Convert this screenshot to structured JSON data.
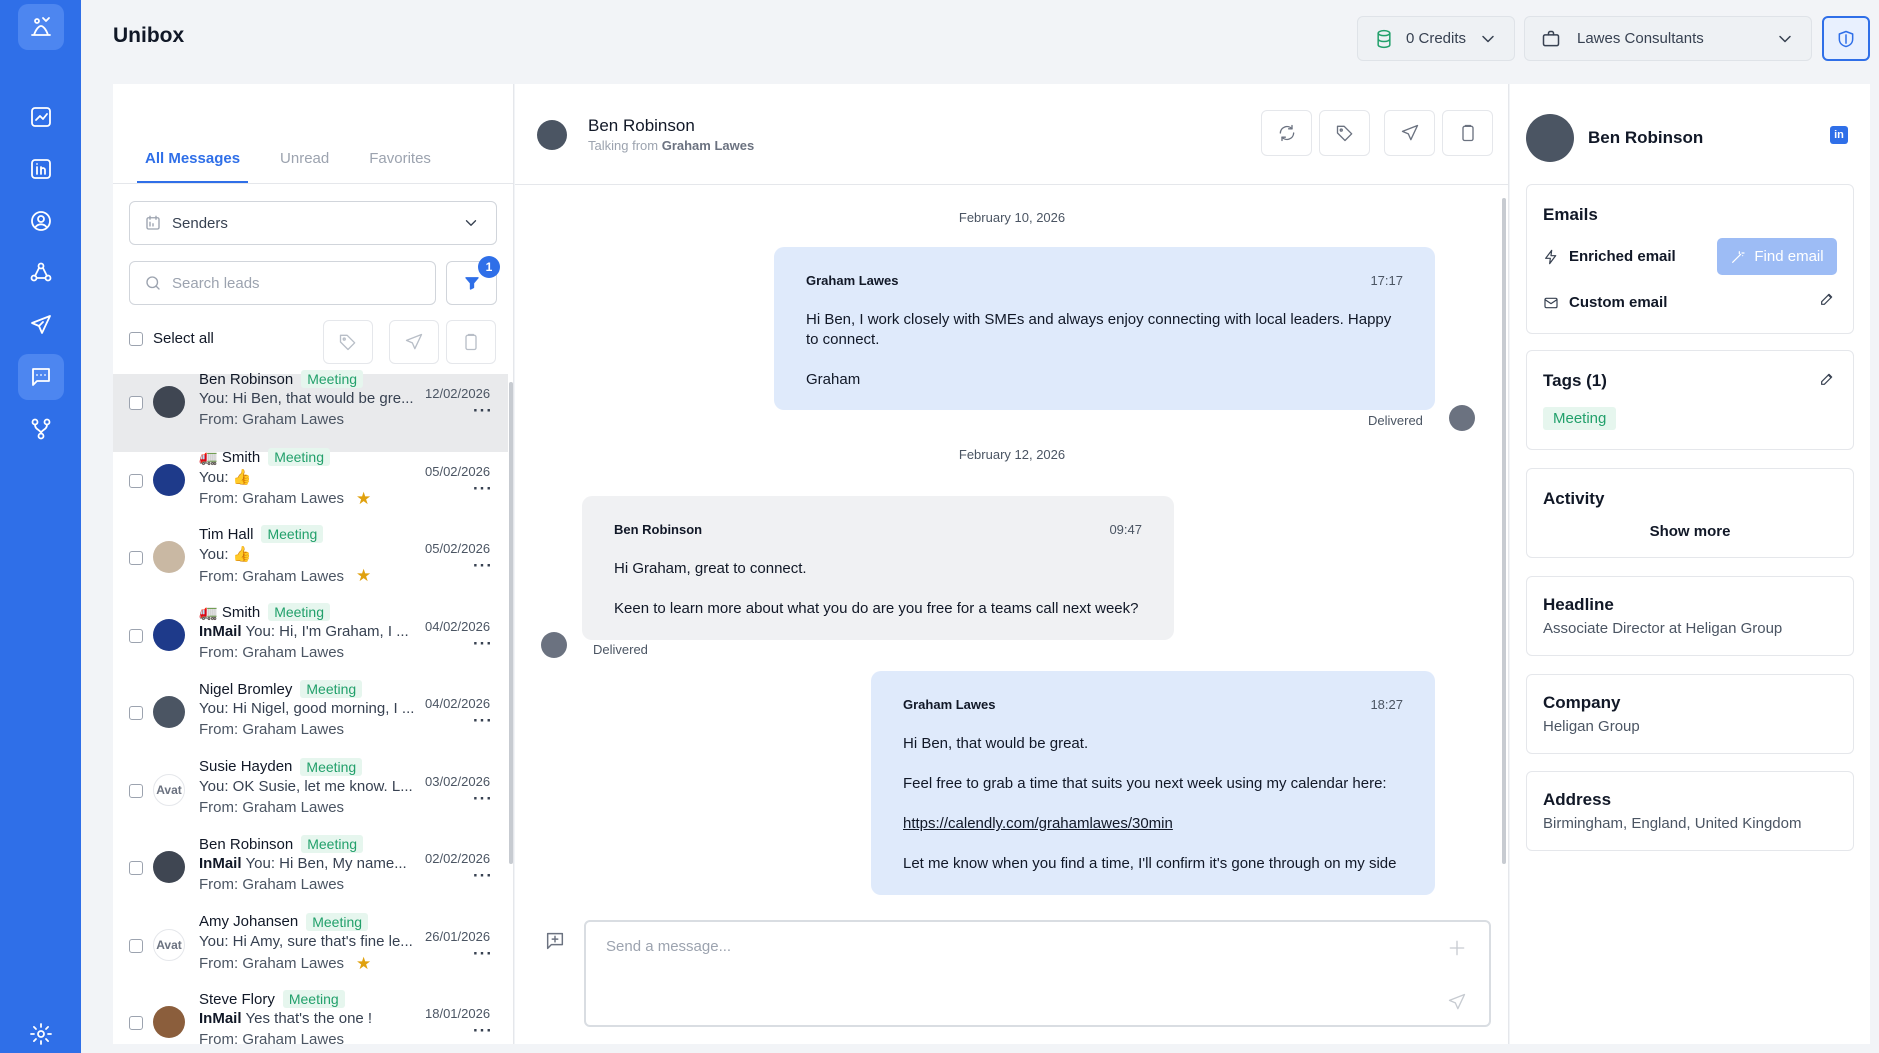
{
  "app": {
    "title": "Unibox"
  },
  "header": {
    "credits_label": "0 Credits",
    "org_label": "Lawes Consultants"
  },
  "sidebar": {
    "items": [
      "logo",
      "analytics",
      "linkedin",
      "contacts",
      "network",
      "campaigns",
      "unibox",
      "workflows",
      "settings"
    ]
  },
  "inbox": {
    "tabs": [
      {
        "label": "All Messages",
        "active": true
      },
      {
        "label": "Unread"
      },
      {
        "label": "Favorites"
      }
    ],
    "senders_label": "Senders",
    "search_placeholder": "Search leads",
    "filter_count": "1",
    "select_all_label": "Select all",
    "conversations": [
      {
        "name": "Ben Robinson",
        "tag": "Meeting",
        "prefix": "",
        "preview": "You: Hi Ben, that would be gre...",
        "from": "From: Graham Lawes",
        "date": "12/02/2026",
        "star": false,
        "active": true,
        "avatar_color": "#3f4652"
      },
      {
        "name": "🚛 Smith",
        "tag": "Meeting",
        "prefix": "",
        "preview": "You: 👍",
        "from": "From: Graham Lawes",
        "date": "05/02/2026",
        "star": true,
        "active": false,
        "avatar_color": "#1e3a8a"
      },
      {
        "name": "Tim Hall",
        "tag": "Meeting",
        "prefix": "",
        "preview": "You: 👍",
        "from": "From: Graham Lawes",
        "date": "05/02/2026",
        "star": true,
        "active": false,
        "avatar_color": "#c9b8a3"
      },
      {
        "name": "🚛 Smith",
        "tag": "Meeting",
        "prefix": "InMail",
        "preview": "You: Hi, I'm Graham, I ...",
        "from": "From: Graham Lawes",
        "date": "04/02/2026",
        "star": false,
        "active": false,
        "avatar_color": "#1e3a8a"
      },
      {
        "name": "Nigel Bromley",
        "tag": "Meeting",
        "prefix": "",
        "preview": "You: Hi Nigel, good morning, I ...",
        "from": "From: Graham Lawes",
        "date": "04/02/2026",
        "star": false,
        "active": false,
        "avatar_color": "#4b5563"
      },
      {
        "name": "Susie Hayden",
        "tag": "Meeting",
        "prefix": "",
        "preview": "You: OK Susie, let me know. L...",
        "from": "From: Graham Lawes",
        "date": "03/02/2026",
        "star": false,
        "active": false,
        "avatar_color": "#ffffff",
        "avatar_text": "Avat"
      },
      {
        "name": "Ben Robinson",
        "tag": "Meeting",
        "prefix": "InMail",
        "preview": "You: Hi Ben, My name...",
        "from": "From: Graham Lawes",
        "date": "02/02/2026",
        "star": false,
        "active": false,
        "avatar_color": "#3f4652"
      },
      {
        "name": "Amy Johansen",
        "tag": "Meeting",
        "prefix": "",
        "preview": "You: Hi Amy, sure that's fine le...",
        "from": "From: Graham Lawes",
        "date": "26/01/2026",
        "star": true,
        "active": false,
        "avatar_color": "#ffffff",
        "avatar_text": "Avat"
      },
      {
        "name": "Steve Flory",
        "tag": "Meeting",
        "prefix": "InMail",
        "preview": "Yes that's the one !",
        "from": "From: Graham Lawes",
        "date": "18/01/2026",
        "star": false,
        "active": false,
        "avatar_color": "#8b5e3c"
      }
    ]
  },
  "thread": {
    "contact_name": "Ben Robinson",
    "talking_from_prefix": "Talking from",
    "talking_from_name": "Graham Lawes",
    "date_1": "February 10, 2026",
    "date_2": "February 12, 2026",
    "msg1": {
      "sender": "Graham Lawes",
      "time": "17:17",
      "line1": "Hi Ben, I work closely with SMEs and always enjoy connecting with local leaders. Happy to connect.",
      "line2": "Graham",
      "status": "Delivered"
    },
    "msg2": {
      "sender": "Ben Robinson",
      "time": "09:47",
      "line1": "Hi Graham, great to connect.",
      "line2": "Keen to learn more about what you do are you free for a teams call next week?",
      "status": "Delivered"
    },
    "msg3": {
      "sender": "Graham Lawes",
      "time": "18:27",
      "line1": "Hi Ben, that would be great.",
      "line2": "Feel free to grab a time that suits you next week using my calendar here:",
      "link": "https://calendly.com/grahamlawes/30min",
      "line3": "Let me know when you find a time, I'll confirm it's gone through on my side"
    },
    "composer_placeholder": "Send a message..."
  },
  "profile": {
    "name": "Ben Robinson",
    "linkedin_badge": "in",
    "emails_title": "Emails",
    "enriched_label": "Enriched email",
    "find_email_label": "Find email",
    "custom_label": "Custom email",
    "tags_title": "Tags (1)",
    "tag": "Meeting",
    "activity_title": "Activity",
    "show_more": "Show more",
    "headline_title": "Headline",
    "headline": "Associate Director at Heligan Group",
    "company_title": "Company",
    "company": "Heligan Group",
    "address_title": "Address",
    "address": "Birmingham, England, United Kingdom"
  }
}
